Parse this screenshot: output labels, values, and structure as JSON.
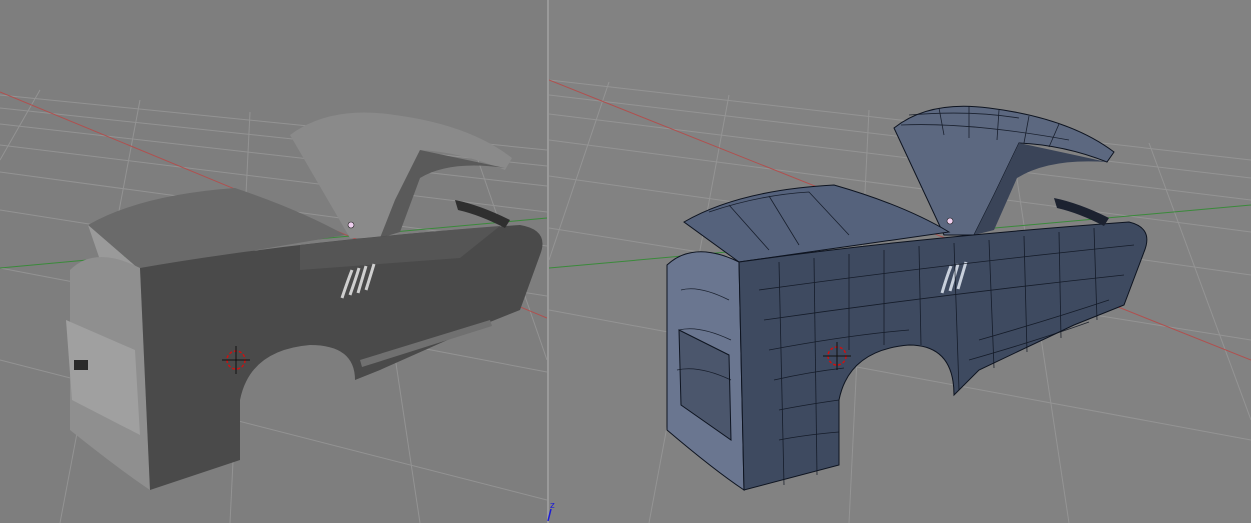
{
  "viewports": {
    "left": {
      "shading": "solid"
    },
    "right": {
      "shading": "wireframe-overlay"
    }
  },
  "nav_gizmo": {
    "axis_label": "z"
  },
  "colors": {
    "background": "#808080",
    "grid": "#8e8e8e",
    "x_axis": "#b0504f",
    "y_axis": "#3a8a3a",
    "solid_body": "#4a4a4a",
    "wire_body": "#3e4a60",
    "wire_lines": "#0e1420",
    "cursor": "#cc1111"
  }
}
